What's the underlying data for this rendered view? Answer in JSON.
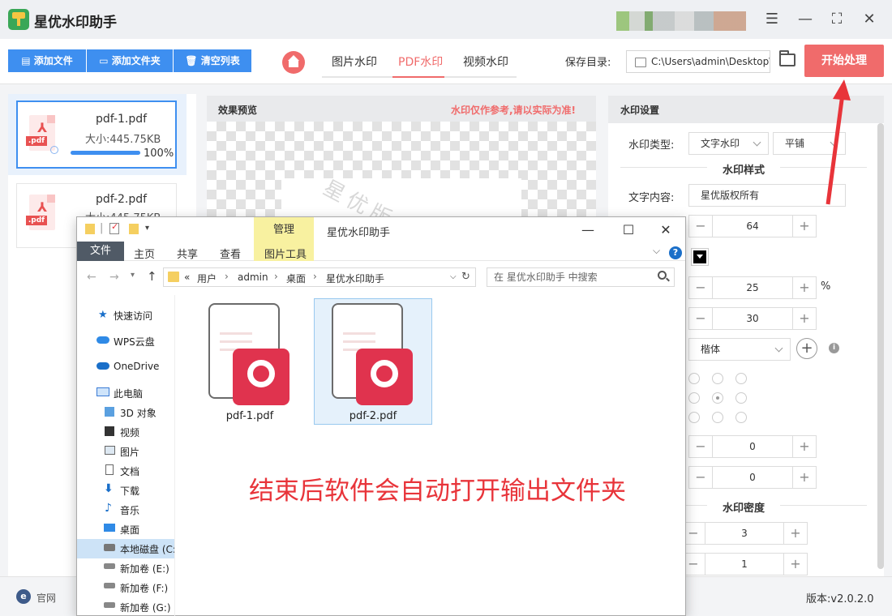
{
  "app": {
    "title": "星优水印助手",
    "window_controls": {
      "settings": "☰",
      "minimize": "—",
      "maximize": "⛶",
      "close": "✕"
    }
  },
  "toolbar": {
    "add_file": "添加文件",
    "add_folder": "添加文件夹",
    "clear_list": "清空列表",
    "tabs": [
      "图片水印",
      "PDF水印",
      "视频水印"
    ],
    "active_tab": "PDF水印",
    "save_dir_label": "保存目录:",
    "save_dir_value": "C:\\Users\\admin\\Desktop\\",
    "start_button": "开始处理"
  },
  "files": [
    {
      "name": "pdf-1.pdf",
      "size": "大小:445.75KB",
      "progress": 100,
      "progress_text": "100%",
      "selected": true
    },
    {
      "name": "pdf-2.pdf",
      "size": "大小:445.75KB",
      "selected": false
    }
  ],
  "preview": {
    "title": "效果预览",
    "note": "水印仅作参考,请以实际为准!",
    "watermark_text": "星优版"
  },
  "settings": {
    "title": "水印设置",
    "type_label": "水印类型:",
    "type_value": "文字水印",
    "layout_value": "平铺",
    "style_section": "水印样式",
    "content_label": "文字内容:",
    "content_value": "星优版权所有",
    "font_size": "64",
    "opacity": "25",
    "opacity_unit": "%",
    "rotation": "30",
    "font_family": "楷体",
    "offset_x": "0",
    "offset_y": "0",
    "density_section": "水印密度",
    "density_x": "3",
    "density_y": "1"
  },
  "bottom": {
    "website": "官网",
    "version": "版本:v2.0.2.0"
  },
  "explorer": {
    "manage_tab": "管理",
    "title": "星优水印助手",
    "ribbon_tabs": [
      "文件",
      "主页",
      "共享",
      "查看"
    ],
    "picture_tools": "图片工具",
    "breadcrumb": [
      "«",
      "用户",
      "admin",
      "桌面",
      "星优水印助手"
    ],
    "search_placeholder": "在 星优水印助手 中搜索",
    "nav": [
      {
        "label": "快速访问",
        "icon": "star-icon"
      },
      {
        "label": "WPS云盘",
        "icon": "cloud-icon"
      },
      {
        "label": "OneDrive",
        "icon": "cloud-icon"
      },
      {
        "label": "此电脑",
        "icon": "computer-icon"
      },
      {
        "label": "3D 对象",
        "icon": "cube-icon"
      },
      {
        "label": "视频",
        "icon": "video-icon"
      },
      {
        "label": "图片",
        "icon": "picture-icon"
      },
      {
        "label": "文档",
        "icon": "document-icon"
      },
      {
        "label": "下载",
        "icon": "download-icon"
      },
      {
        "label": "音乐",
        "icon": "music-icon"
      },
      {
        "label": "桌面",
        "icon": "desktop-icon"
      },
      {
        "label": "本地磁盘 (C:",
        "icon": "drive-icon"
      },
      {
        "label": "新加卷 (E:)",
        "icon": "drive-icon"
      },
      {
        "label": "新加卷 (F:)",
        "icon": "drive-icon"
      },
      {
        "label": "新加卷 (G:)",
        "icon": "drive-icon"
      }
    ],
    "files": [
      "pdf-1.pdf",
      "pdf-2.pdf"
    ],
    "caption": "结束后软件会自动打开输出文件夹"
  },
  "colors": {
    "accent": "#3e8ff0",
    "brand_red": "#f06b6b",
    "caption_red": "#e8343a"
  }
}
